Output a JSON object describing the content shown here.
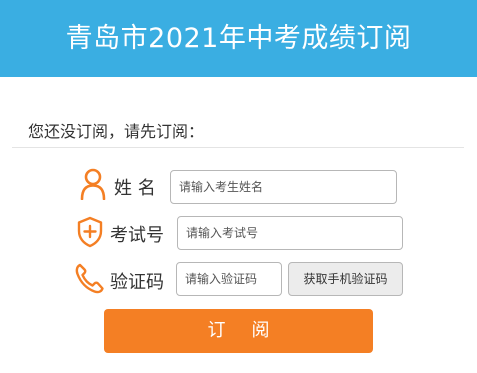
{
  "header": {
    "title": "青岛市2021年中考成绩订阅"
  },
  "prompt": "您还没订阅，请先订阅：",
  "form": {
    "name": {
      "label": "姓 名",
      "placeholder": "请输入考生姓名",
      "icon": "person-icon"
    },
    "exam_id": {
      "label": "考试号",
      "placeholder": "请输入考试号",
      "icon": "shield-plus-icon"
    },
    "code": {
      "label": "验证码",
      "placeholder": "请输入验证码",
      "icon": "phone-icon",
      "send_button": "获取手机验证码"
    }
  },
  "submit_label": "订阅",
  "colors": {
    "header": "#3aaee2",
    "accent": "#f47f24"
  }
}
